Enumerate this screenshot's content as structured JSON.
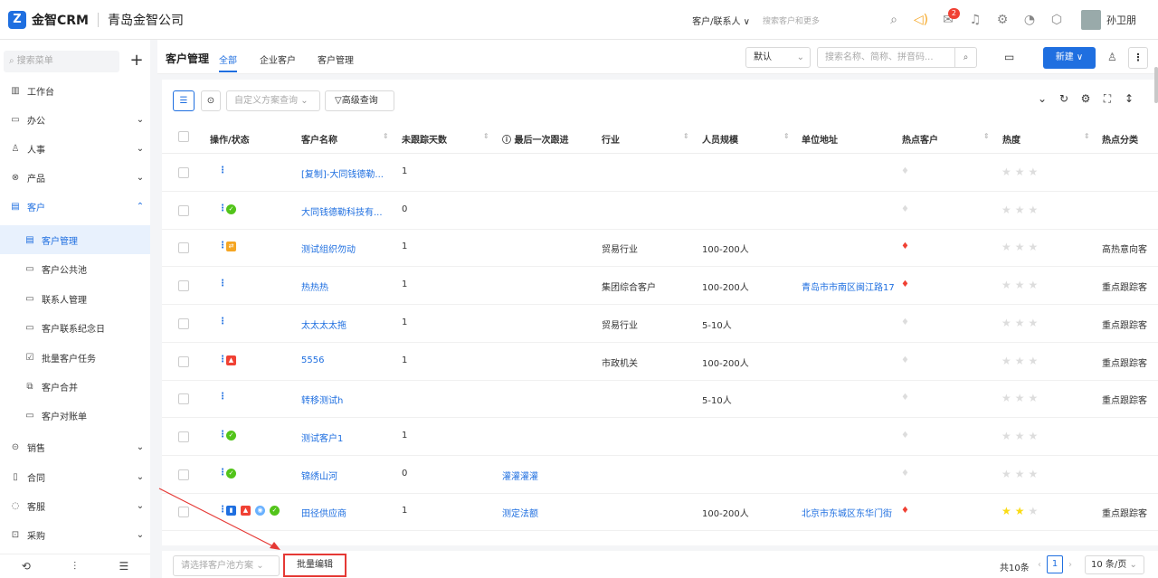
{
  "topbar": {
    "logo_mark": "Z",
    "app_name": "金智CRM",
    "company": "青岛金智公司",
    "search_scope": "客户/联系人 ∨",
    "search_placeholder": "搜索客户和更多",
    "notice_badge": "2",
    "user_name": "孙卫朋"
  },
  "sidebar": {
    "search_placeholder": "搜索菜单",
    "add_label": "+",
    "items": [
      {
        "icon": "▥",
        "label": "工作台",
        "chev": ""
      },
      {
        "icon": "▭",
        "label": "办公",
        "chev": "⌄"
      },
      {
        "icon": "♙",
        "label": "人事",
        "chev": "⌄"
      },
      {
        "icon": "⊗",
        "label": "产品",
        "chev": "⌄"
      },
      {
        "icon": "▤",
        "label": "客户",
        "chev": "⌃"
      }
    ],
    "sub_items": [
      {
        "icon": "▤",
        "label": "客户管理"
      },
      {
        "icon": "▭",
        "label": "客户公共池"
      },
      {
        "icon": "▭",
        "label": "联系人管理"
      },
      {
        "icon": "▭",
        "label": "客户联系纪念日"
      },
      {
        "icon": "☑",
        "label": "批量客户任务"
      },
      {
        "icon": "⧉",
        "label": "客户合并"
      },
      {
        "icon": "▭",
        "label": "客户对账单"
      }
    ],
    "bottom_items": [
      {
        "icon": "⊝",
        "label": "销售",
        "chev": "⌄"
      },
      {
        "icon": "▯",
        "label": "合同",
        "chev": "⌄"
      },
      {
        "icon": "◌",
        "label": "客服",
        "chev": "⌄"
      },
      {
        "icon": "⊡",
        "label": "采购",
        "chev": "⌄"
      }
    ]
  },
  "header": {
    "title": "客户管理",
    "tabs": [
      "全部",
      "企业客户",
      "客户管理"
    ],
    "sort_select": "默认",
    "search_placeholder": "搜索名称、简称、拼音码...",
    "new_button": "新建 ∨"
  },
  "toolbar": {
    "custom_query_placeholder": "自定义方案查询",
    "advanced_query": "高级查询"
  },
  "table": {
    "columns": [
      "操作/状态",
      "客户名称",
      "未跟踪天数",
      "最后一次跟进",
      "行业",
      "人员规模",
      "单位地址",
      "热点客户",
      "热度",
      "热点分类"
    ],
    "rows": [
      {
        "name": "[复制]-大同钱德勒...",
        "days": "1",
        "last": "",
        "industry": "",
        "size": "",
        "address": "",
        "hot": "gray",
        "stars": 0,
        "category": "",
        "status": []
      },
      {
        "name": "大同钱德勒科技有...",
        "days": "0",
        "last": "",
        "industry": "",
        "size": "",
        "address": "",
        "hot": "gray",
        "stars": 0,
        "category": "",
        "status": [
          "green"
        ]
      },
      {
        "name": "测试组织勿动",
        "days": "1",
        "last": "",
        "industry": "贸易行业",
        "size": "100-200人",
        "address": "",
        "hot": "red",
        "stars": 0,
        "category": "高热意向客",
        "status": [
          "orange"
        ]
      },
      {
        "name": "热热热",
        "days": "1",
        "last": "",
        "industry": "集团综合客户",
        "size": "100-200人",
        "address": "青岛市市南区闽江路17",
        "hot": "red",
        "stars": 0,
        "category": "重点跟踪客",
        "status": []
      },
      {
        "name": "太太太太拖",
        "days": "1",
        "last": "",
        "industry": "贸易行业",
        "size": "5-10人",
        "address": "",
        "hot": "gray",
        "stars": 0,
        "category": "重点跟踪客",
        "status": []
      },
      {
        "name": "5556",
        "days": "1",
        "last": "",
        "industry": "市政机关",
        "size": "100-200人",
        "address": "",
        "hot": "gray",
        "stars": 0,
        "category": "重点跟踪客",
        "status": [
          "red"
        ]
      },
      {
        "name": "转移测试h",
        "days": "",
        "last": "",
        "industry": "",
        "size": "5-10人",
        "address": "",
        "hot": "gray",
        "stars": 0,
        "category": "重点跟踪客",
        "status": []
      },
      {
        "name": "测试客户1",
        "days": "1",
        "last": "",
        "industry": "",
        "size": "",
        "address": "",
        "hot": "gray",
        "stars": 0,
        "category": "",
        "status": [
          "green"
        ]
      },
      {
        "name": "锦绣山河",
        "days": "0",
        "last": "灌灌灌灌",
        "industry": "",
        "size": "",
        "address": "",
        "hot": "gray",
        "stars": 0,
        "category": "",
        "status": [
          "green"
        ]
      },
      {
        "name": "田径供应商",
        "days": "1",
        "last": "测定法额",
        "industry": "",
        "size": "100-200人",
        "address": "北京市东城区东华门街",
        "hot": "red",
        "stars": 2,
        "category": "重点跟踪客",
        "status": [
          "blue",
          "red",
          "lightblue",
          "green"
        ]
      }
    ]
  },
  "footer": {
    "pool_placeholder": "请选择客户池方案",
    "batch_edit": "批量编辑",
    "total": "共10条",
    "page": "1",
    "page_size": "10 条/页"
  },
  "colors": {
    "accent": "#1f6fe0",
    "annotation": "#e53935"
  }
}
